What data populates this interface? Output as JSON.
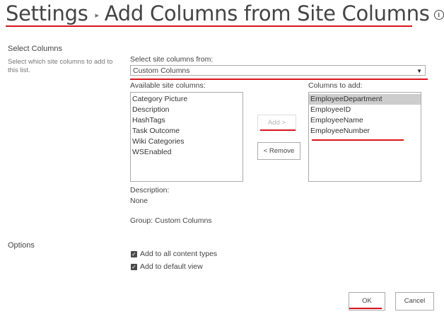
{
  "header": {
    "breadcrumb_root": "Settings",
    "page_title": "Add Columns from Site Columns",
    "info_glyph": "i"
  },
  "select_columns": {
    "title": "Select Columns",
    "description": "Select which site columns to add to this list.",
    "from_label": "Select site columns from:",
    "from_value": "Custom Columns",
    "available_label": "Available site columns:",
    "available": [
      "Category Picture",
      "Description",
      "HashTags",
      "Task Outcome",
      "Wiki Categories",
      "WSEnabled"
    ],
    "to_add_label": "Columns to add:",
    "to_add": [
      "EmployeeDepartment",
      "EmployeeID",
      "EmployeeName",
      "EmployeeNumber"
    ],
    "add_button": "Add >",
    "remove_button": "< Remove",
    "description_label": "Description:",
    "description_value": "None",
    "group_text": "Group: Custom Columns"
  },
  "options": {
    "title": "Options",
    "add_to_content_types": "Add to all content types",
    "add_to_default_view": "Add to default view"
  },
  "footer": {
    "ok_label": "OK",
    "cancel_label": "Cancel"
  },
  "colors": {
    "annotation": "#d9141c",
    "selected_item": "#cdcdcd",
    "text": "#444444"
  },
  "icons": {
    "sep": "breadcrumb-arrow-icon",
    "info": "info-icon",
    "dropdown": "chevron-down-icon",
    "check": "checkmark-icon"
  }
}
